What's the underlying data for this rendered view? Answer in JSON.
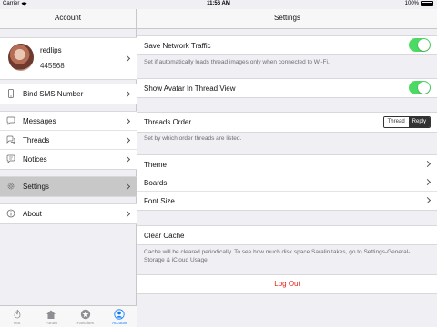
{
  "status": {
    "carrier": "Carrier",
    "time": "11:56 AM",
    "battery": "100%"
  },
  "left": {
    "title": "Account",
    "profile": {
      "name": "redlips",
      "uid": "445568"
    },
    "items": [
      {
        "label": "Bind SMS Number",
        "icon": "phone-icon"
      },
      {
        "label": "Messages",
        "icon": "chat-bubble-icon"
      },
      {
        "label": "Threads",
        "icon": "threads-icon"
      },
      {
        "label": "Notices",
        "icon": "notice-icon"
      },
      {
        "label": "Settings",
        "icon": "gear-icon"
      },
      {
        "label": "About",
        "icon": "info-icon"
      }
    ],
    "tabs": [
      {
        "label": "Hot",
        "icon": "flame-icon"
      },
      {
        "label": "Forum",
        "icon": "house-icon"
      },
      {
        "label": "Favorites",
        "icon": "star-icon"
      },
      {
        "label": "Account",
        "icon": "person-icon"
      }
    ]
  },
  "right": {
    "title": "Settings",
    "save_traffic": {
      "label": "Save Network Traffic",
      "on": true,
      "note": "Set if automatically loads thread images only when connected to Wi-Fi."
    },
    "show_avatar": {
      "label": "Show Avatar In Thread View",
      "on": true
    },
    "threads_order": {
      "label": "Threads Order",
      "options": [
        "Thread",
        "Reply"
      ],
      "selected": "Reply",
      "note": "Set by which order threads are listed."
    },
    "menu": [
      "Theme",
      "Boards",
      "Font Size"
    ],
    "clear_cache": {
      "label": "Clear Cache",
      "note": "Cache will be cleared periodically. To see how much disk space Saralin takes, go to Settings-General-Storage & iCloud Usage"
    },
    "logout": "Log Out"
  },
  "colors": {
    "switch_on": "#4cd964",
    "logout": "#e3241b",
    "tab_active": "#0a7aff"
  }
}
